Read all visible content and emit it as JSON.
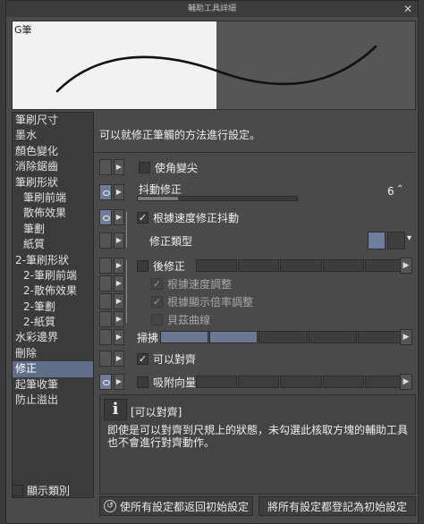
{
  "window": {
    "title": "輔助工具詳細",
    "close_glyph": "✕"
  },
  "preview": {
    "label": "G筆"
  },
  "categories": [
    {
      "label": "筆刷尺寸",
      "sub": false
    },
    {
      "label": "墨水",
      "sub": false
    },
    {
      "label": "顏色變化",
      "sub": false
    },
    {
      "label": "消除鋸齒",
      "sub": false
    },
    {
      "label": "筆刷形狀",
      "sub": false
    },
    {
      "label": "筆刷前端",
      "sub": true
    },
    {
      "label": "散佈效果",
      "sub": true
    },
    {
      "label": "筆劃",
      "sub": true
    },
    {
      "label": "紙質",
      "sub": true
    },
    {
      "label": "2-筆刷形狀",
      "sub": false
    },
    {
      "label": "2-筆刷前端",
      "sub": true
    },
    {
      "label": "2-散佈效果",
      "sub": true
    },
    {
      "label": "2-筆劃",
      "sub": true
    },
    {
      "label": "2-紙質",
      "sub": true
    },
    {
      "label": "水彩邊界",
      "sub": false
    },
    {
      "label": "刪除",
      "sub": false
    },
    {
      "label": "修正",
      "sub": false,
      "selected": true
    },
    {
      "label": "起筆收筆",
      "sub": false
    },
    {
      "label": "防止溢出",
      "sub": false
    }
  ],
  "show_category_label": "顯示類別",
  "description": "可以就修正筆觸的方法進行設定。",
  "settings": {
    "corner_sharp": "使角變尖",
    "stabilization": "抖動修正",
    "stabilization_value": "6",
    "stabilization_level": 0.25,
    "speed_stab": "根據速度修正抖動",
    "correction_type": "修正類型",
    "post_correction": "後修正",
    "speed_adjust": "根據速度調整",
    "zoom_adjust": "根據顯示倍率調整",
    "bezier": "貝茲曲線",
    "sweep": "掃拂",
    "snap": "可以對齊",
    "vector_snap": "吸附向量"
  },
  "info": {
    "icon": "i",
    "title": "[可以對齊]",
    "body": "即使是可以對齊到尺規上的狀態，未勾選此核取方塊的輔助工具也不會進行對齊動作。"
  },
  "buttons": {
    "reset": "使所有設定都返回初始設定",
    "register": "將所有設定都登記為初始設定"
  },
  "colors": {
    "accent": "#6f7c95",
    "panel": "#4a4a4a",
    "dark": "#3b3b3b"
  }
}
